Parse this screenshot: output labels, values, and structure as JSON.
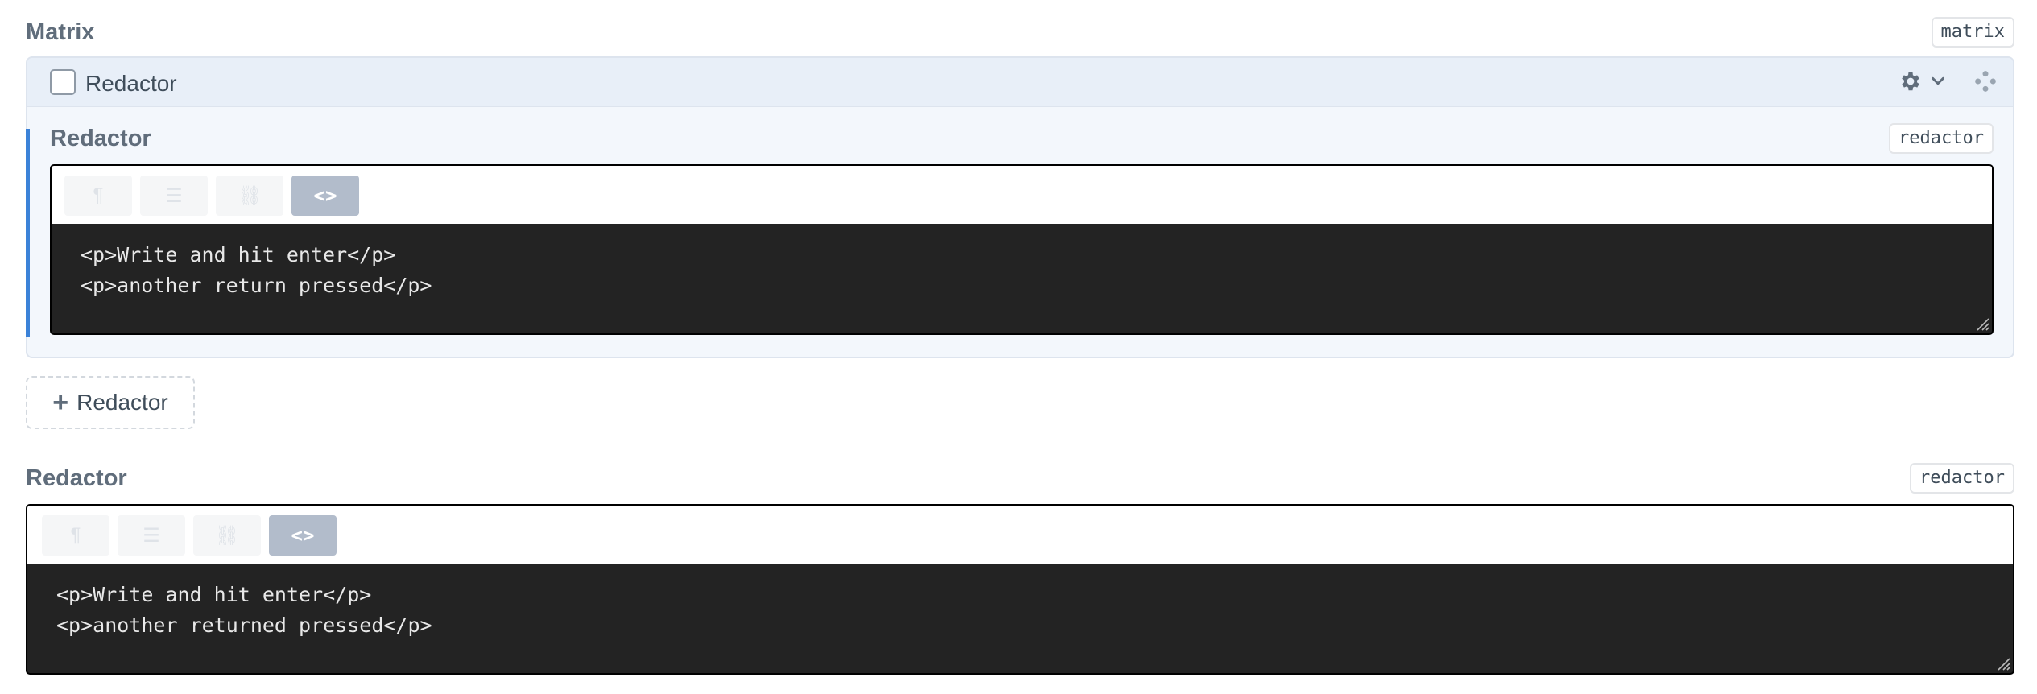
{
  "matrix_field": {
    "label": "Matrix",
    "handle": "matrix",
    "block": {
      "type_title": "Redactor",
      "field_label": "Redactor",
      "field_handle": "redactor",
      "code_lines": [
        "<p>Write and hit enter</p>",
        "<p>another return pressed</p>"
      ]
    },
    "add_button_label": "Redactor",
    "add_button_icon": "+"
  },
  "redactor_field": {
    "label": "Redactor",
    "handle": "redactor",
    "code_lines": [
      "<p>Write and hit enter</p>",
      "<p>another returned pressed</p>"
    ]
  },
  "toolbar": {
    "format_glyph": "¶",
    "list_glyph": "☰",
    "link_glyph": "⛓",
    "html_glyph": "<>"
  },
  "colors": {
    "accent": "#3b82d8",
    "editor_bg": "#232323",
    "active_button": "#b2bccb",
    "block_bg": "#f3f7fc"
  }
}
